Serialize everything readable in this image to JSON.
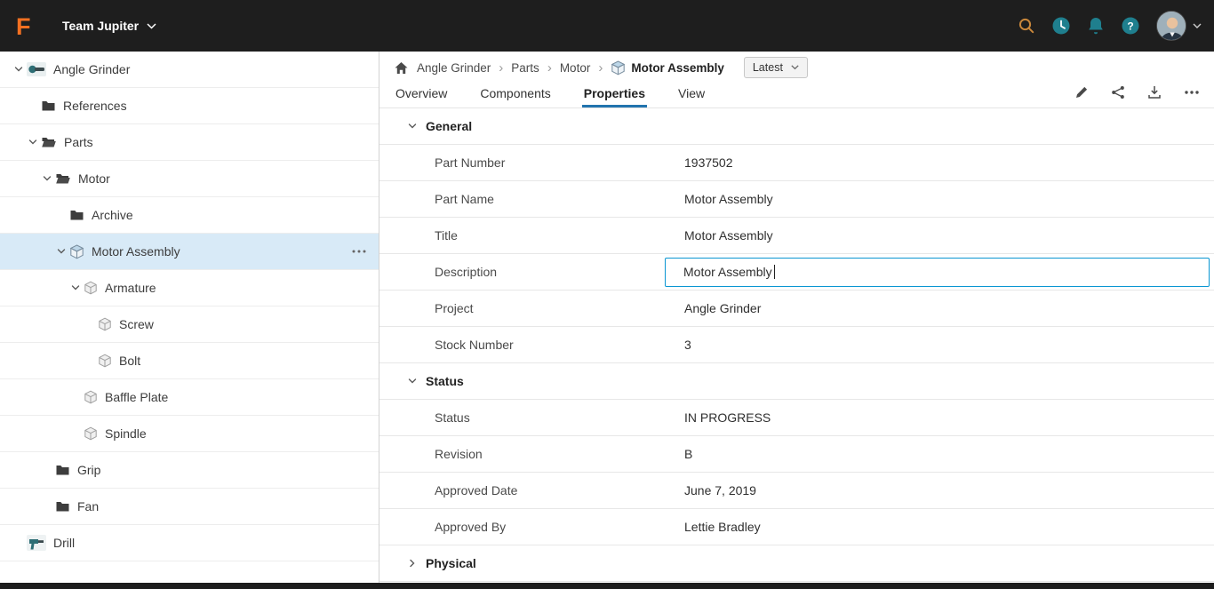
{
  "topbar": {
    "team_name": "Team Jupiter",
    "logo": "fusion-logo",
    "right_icons": [
      "search",
      "clock",
      "notifications",
      "help"
    ],
    "colors": {
      "bar_bg": "#1e1e1e",
      "logo_orange": "#f37021",
      "icon_teal": "#1f7f8e"
    }
  },
  "sidebar": {
    "tree": [
      {
        "label": "Angle Grinder",
        "level": 0,
        "chevron": "down",
        "icon": "grinder-thumb",
        "selected": false
      },
      {
        "label": "References",
        "level": 1,
        "chevron": null,
        "icon": "folder",
        "selected": false
      },
      {
        "label": "Parts",
        "level": 1,
        "chevron": "down",
        "icon": "folder-open",
        "selected": false
      },
      {
        "label": "Motor",
        "level": 2,
        "chevron": "down",
        "icon": "folder-open",
        "selected": false
      },
      {
        "label": "Archive",
        "level": 3,
        "chevron": null,
        "icon": "folder",
        "selected": false
      },
      {
        "label": "Motor Assembly",
        "level": 3,
        "chevron": "down",
        "icon": "assembly",
        "selected": true,
        "menu": true
      },
      {
        "label": "Armature",
        "level": 4,
        "chevron": "down",
        "icon": "part",
        "selected": false
      },
      {
        "label": "Screw",
        "level": 5,
        "chevron": null,
        "icon": "part",
        "selected": false
      },
      {
        "label": "Bolt",
        "level": 5,
        "chevron": null,
        "icon": "part",
        "selected": false
      },
      {
        "label": "Baffle Plate",
        "level": 4,
        "chevron": null,
        "icon": "part",
        "selected": false
      },
      {
        "label": "Spindle",
        "level": 4,
        "chevron": null,
        "icon": "part",
        "selected": false
      },
      {
        "label": "Grip",
        "level": 2,
        "chevron": null,
        "icon": "folder",
        "selected": false
      },
      {
        "label": "Fan",
        "level": 2,
        "chevron": null,
        "icon": "folder",
        "selected": false
      },
      {
        "label": "Drill",
        "level": 0,
        "chevron": null,
        "icon": "drill-thumb",
        "selected": false
      }
    ],
    "selected_bg": "#d8eaf7"
  },
  "breadcrumb": {
    "items": [
      {
        "label": "Angle Grinder",
        "current": false
      },
      {
        "label": "Parts",
        "current": false
      },
      {
        "label": "Motor",
        "current": false
      },
      {
        "label": "Motor Assembly",
        "current": true,
        "icon": "assembly"
      }
    ],
    "version_label": "Latest"
  },
  "tabs": [
    {
      "label": "Overview",
      "active": false
    },
    {
      "label": "Components",
      "active": false
    },
    {
      "label": "Properties",
      "active": true
    },
    {
      "label": "View",
      "active": false
    }
  ],
  "toolbar": {
    "icons": [
      "edit",
      "share",
      "download",
      "more"
    ]
  },
  "properties": {
    "sections": [
      {
        "title": "General",
        "collapsed": false,
        "rows": [
          {
            "label": "Part Number",
            "value": "1937502"
          },
          {
            "label": "Part Name",
            "value": "Motor Assembly"
          },
          {
            "label": "Title",
            "value": "Motor Assembly"
          },
          {
            "label": "Description",
            "value": "Motor Assembly",
            "editing": true
          },
          {
            "label": "Project",
            "value": "Angle Grinder"
          },
          {
            "label": "Stock Number",
            "value": "3"
          }
        ]
      },
      {
        "title": "Status",
        "collapsed": false,
        "rows": [
          {
            "label": "Status",
            "value": "IN PROGRESS"
          },
          {
            "label": "Revision",
            "value": "B"
          },
          {
            "label": "Approved Date",
            "value": "June 7, 2019"
          },
          {
            "label": "Approved By",
            "value": "Lettie Bradley"
          }
        ]
      },
      {
        "title": "Physical",
        "collapsed": true,
        "rows": []
      }
    ],
    "accent_edit_border": "#0a96d2"
  }
}
